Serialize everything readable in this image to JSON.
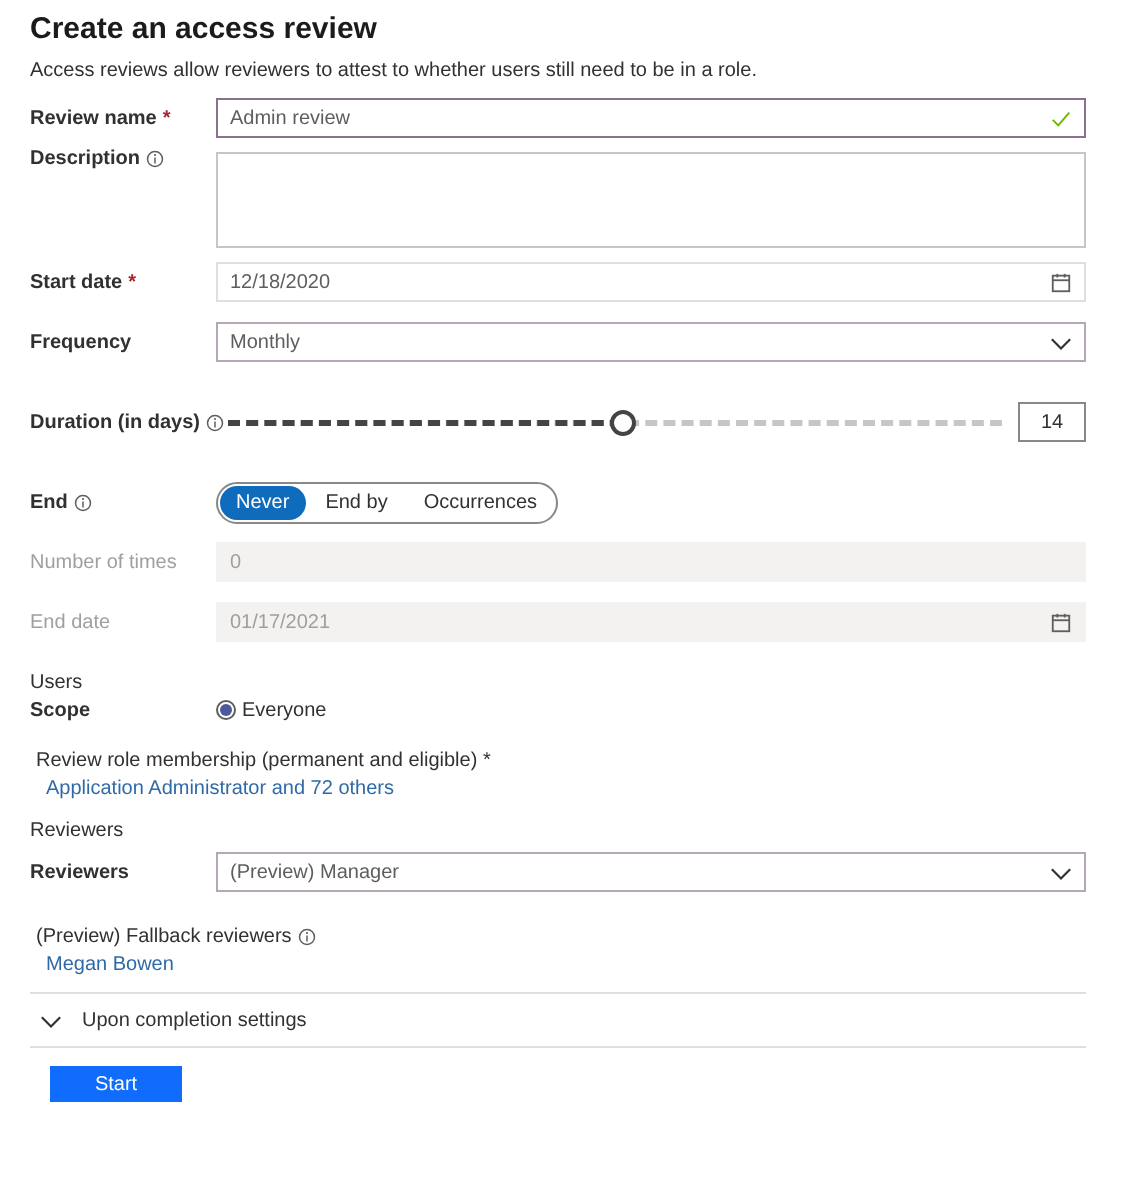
{
  "title": "Create an access review",
  "intro": "Access reviews allow reviewers to attest to whether users still need to be in a role.",
  "rows": [
    {
      "kind": "text",
      "label": "Review name",
      "required_mark": "*",
      "value": "Admin review",
      "valid": true,
      "focused": true
    },
    {
      "kind": "textarea",
      "label": "Description",
      "info": true
    },
    {
      "kind": "date",
      "label": "Start date",
      "required_mark": "*",
      "value": "12/18/2020",
      "disabled": false
    },
    {
      "kind": "select",
      "label": "Frequency",
      "value": "Monthly"
    },
    {
      "kind": "slider",
      "label": "Duration (in days)",
      "info": true,
      "level": 0.51,
      "reading": "14"
    },
    {
      "kind": "segmented",
      "label": "End",
      "info": true,
      "options": [
        {
          "label": "Never",
          "selected": true
        },
        {
          "label": "End by",
          "selected": false
        },
        {
          "label": "Occurrences",
          "selected": false
        }
      ]
    },
    {
      "kind": "text",
      "label": "Number of times",
      "value": "0",
      "disabled": true
    },
    {
      "kind": "date",
      "label": "End date",
      "value": "01/17/2021",
      "disabled": true
    },
    {
      "kind": "heading",
      "text": "Users"
    },
    {
      "kind": "radio",
      "label": "Scope",
      "options": [
        {
          "label": "Everyone",
          "selected": true
        }
      ]
    },
    {
      "kind": "caption",
      "text": "Review role membership (permanent and eligible) *"
    },
    {
      "kind": "link",
      "text": "Application Administrator and 72 others"
    },
    {
      "kind": "heading",
      "text": "Reviewers"
    },
    {
      "kind": "select",
      "label": "Reviewers",
      "value": "(Preview) Manager"
    },
    {
      "kind": "caption",
      "text": "(Preview) Fallback reviewers",
      "info": true
    },
    {
      "kind": "link",
      "text": "Megan Bowen"
    },
    {
      "kind": "collapse",
      "text": "Upon completion settings",
      "expanded": false
    },
    {
      "kind": "button",
      "text": "Start"
    }
  ]
}
